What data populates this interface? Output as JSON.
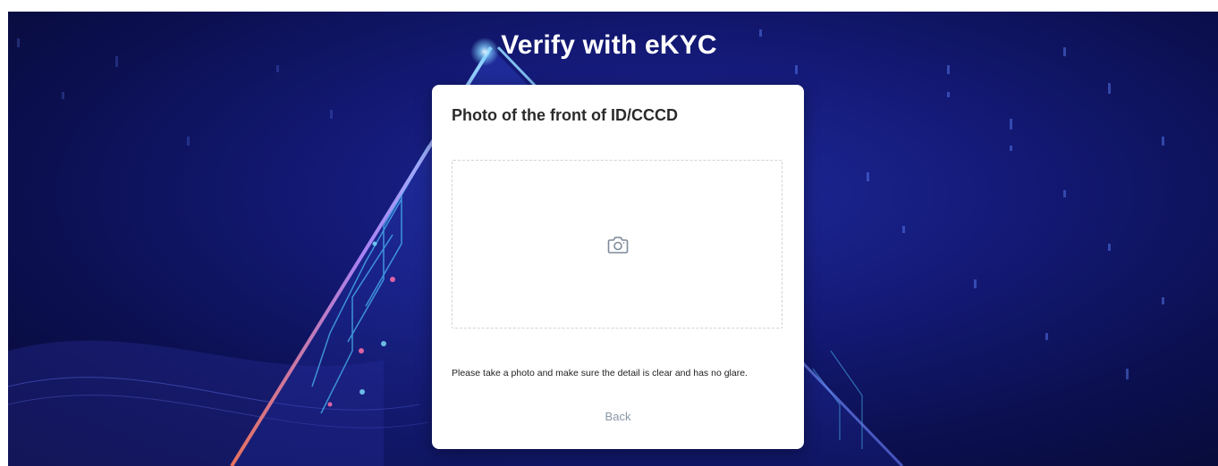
{
  "header": {
    "title": "Verify with eKYC"
  },
  "card": {
    "title": "Photo of the front of ID/CCCD",
    "upload_icon": "camera-icon",
    "instruction": "Please take a photo and make sure the detail is clear and has no glare.",
    "back_label": "Back"
  },
  "colors": {
    "background": "#141a78",
    "card": "#ffffff",
    "title_text": "#ffffff",
    "back_text": "#8a97a6"
  }
}
